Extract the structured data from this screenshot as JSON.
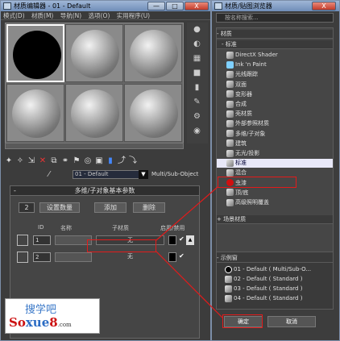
{
  "left_window": {
    "title": "材质编辑器 - 01 - Default",
    "menu": [
      "模式(D)",
      "材质(M)",
      "导航(N)",
      "选项(O)",
      "实用程序(U)"
    ],
    "min": "—",
    "max": "□",
    "close": "X",
    "material_name": "01 - Default",
    "material_type": "Multi/Sub-Object",
    "rollout_title": "多维/子对象基本参数",
    "rollout_toggle": "-",
    "count_value": "2",
    "set_count": "设置数量",
    "add": "添加",
    "delete": "删除",
    "headers": {
      "id": "ID",
      "name": "名称",
      "submat": "子材质",
      "enable": "启用/禁用"
    },
    "rows": [
      {
        "id": "1",
        "sub": "无"
      },
      {
        "id": "2",
        "sub": "无"
      }
    ]
  },
  "logo": {
    "cn": "搜学吧",
    "en1": "So",
    "en2": "xue",
    "en3": "8",
    "dom": ".com"
  },
  "right_window": {
    "title": "材质/贴图浏览器",
    "search_placeholder": "按名称搜索...",
    "section_materials": "- 材质",
    "section_standard": "- 标准",
    "items": [
      "DirectX Shader",
      "Ink 'n Paint",
      "光线跟踪",
      "双面",
      "变形器",
      "合成",
      "壳材质",
      "外部参照材质",
      "多维/子对象",
      "建筑",
      "无光/投影",
      "标准",
      "混合",
      "虫漆",
      "顶/底",
      "高级照明覆盖"
    ],
    "section_scene": "+ 场景材质",
    "section_samples": "- 示例窗",
    "samples": [
      "01 - Default ( Multi/Sub-O...",
      "02 - Default ( Standard )",
      "03 - Default ( Standard )",
      "04 - Default ( Standard )"
    ],
    "ok": "确定",
    "cancel": "取消"
  }
}
